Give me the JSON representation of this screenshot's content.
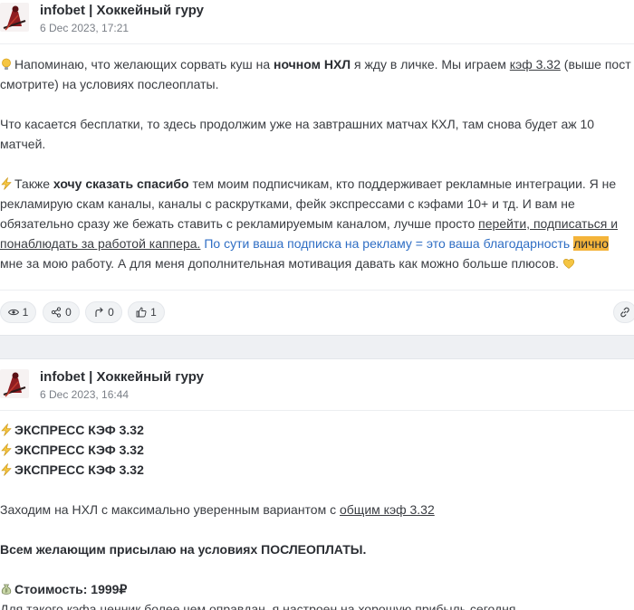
{
  "posts": [
    {
      "channel": "infobet | Хоккейный гуру",
      "date": "6 Dec 2023, 17:21",
      "paragraphs": {
        "p1": {
          "a": "Напоминаю, что желающих сорвать куш на ",
          "b": "ночном НХЛ",
          "c": " я жду в личке. Мы играем ",
          "link": "кэф 3.32",
          "d": " (выше пост",
          "line2": "смотрите) на условиях послеоплаты."
        },
        "p2": {
          "line1": "Что касается бесплатки, то здесь продолжим уже на завтрашних матчах КХЛ, там снова будет аж 10",
          "line2": "матчей."
        },
        "p3": {
          "a": "Также ",
          "b": "хочу сказать спасибо",
          "c": " тем моим подписчикам, кто поддерживает рекламные интеграции. Я не",
          "line2": "рекламирую скам каналы, каналы с раскрутками, фейк экспрессами с кэфами 10+ и тд. И вам не",
          "line3a": "обязательно сразу же бежать ставить с рекламируемым каналом, лучше просто ",
          "line3link": "перейти, подписаться и",
          "line4link": "понаблюдать за работой каппера.",
          "line4b": " По сути ваша подписка на рекламу = это ваша благодарность ",
          "line4hl": "лично",
          "line5": "мне за мою работу. А для меня дополнительная мотивация давать как можно больше плюсов. "
        }
      },
      "stats": {
        "views": "1",
        "shares": "0",
        "forwards": "0",
        "likes": "1"
      }
    },
    {
      "channel": "infobet | Хоккейный гуру",
      "date": "6 Dec 2023, 16:44",
      "lines": {
        "e1": "ЭКСПРЕСС КЭФ 3.32",
        "e2": "ЭКСПРЕСС КЭФ 3.32",
        "e3": "ЭКСПРЕСС КЭФ 3.32",
        "p1a": "Заходим на НХЛ с максимально уверенным вариантом с ",
        "p1link": "общим кэф 3.32",
        "p2": "Всем желающим присылаю на условиях ПОСЛЕОПЛАТЫ.",
        "p3": "Стоимость: 1999₽",
        "p4": "Для такого кэфа ценник более чем оправдан, я настроен на хорошую прибыль сегодня."
      }
    }
  ],
  "icons": {
    "bulb": "lightbulb-icon",
    "bolt": "lightning-icon",
    "heart": "yellow-heart-icon",
    "money": "money-bag-icon"
  },
  "colors": {
    "highlight": "#f4b43a",
    "link": "#2f6ec4",
    "separator": "#eef0f3"
  }
}
